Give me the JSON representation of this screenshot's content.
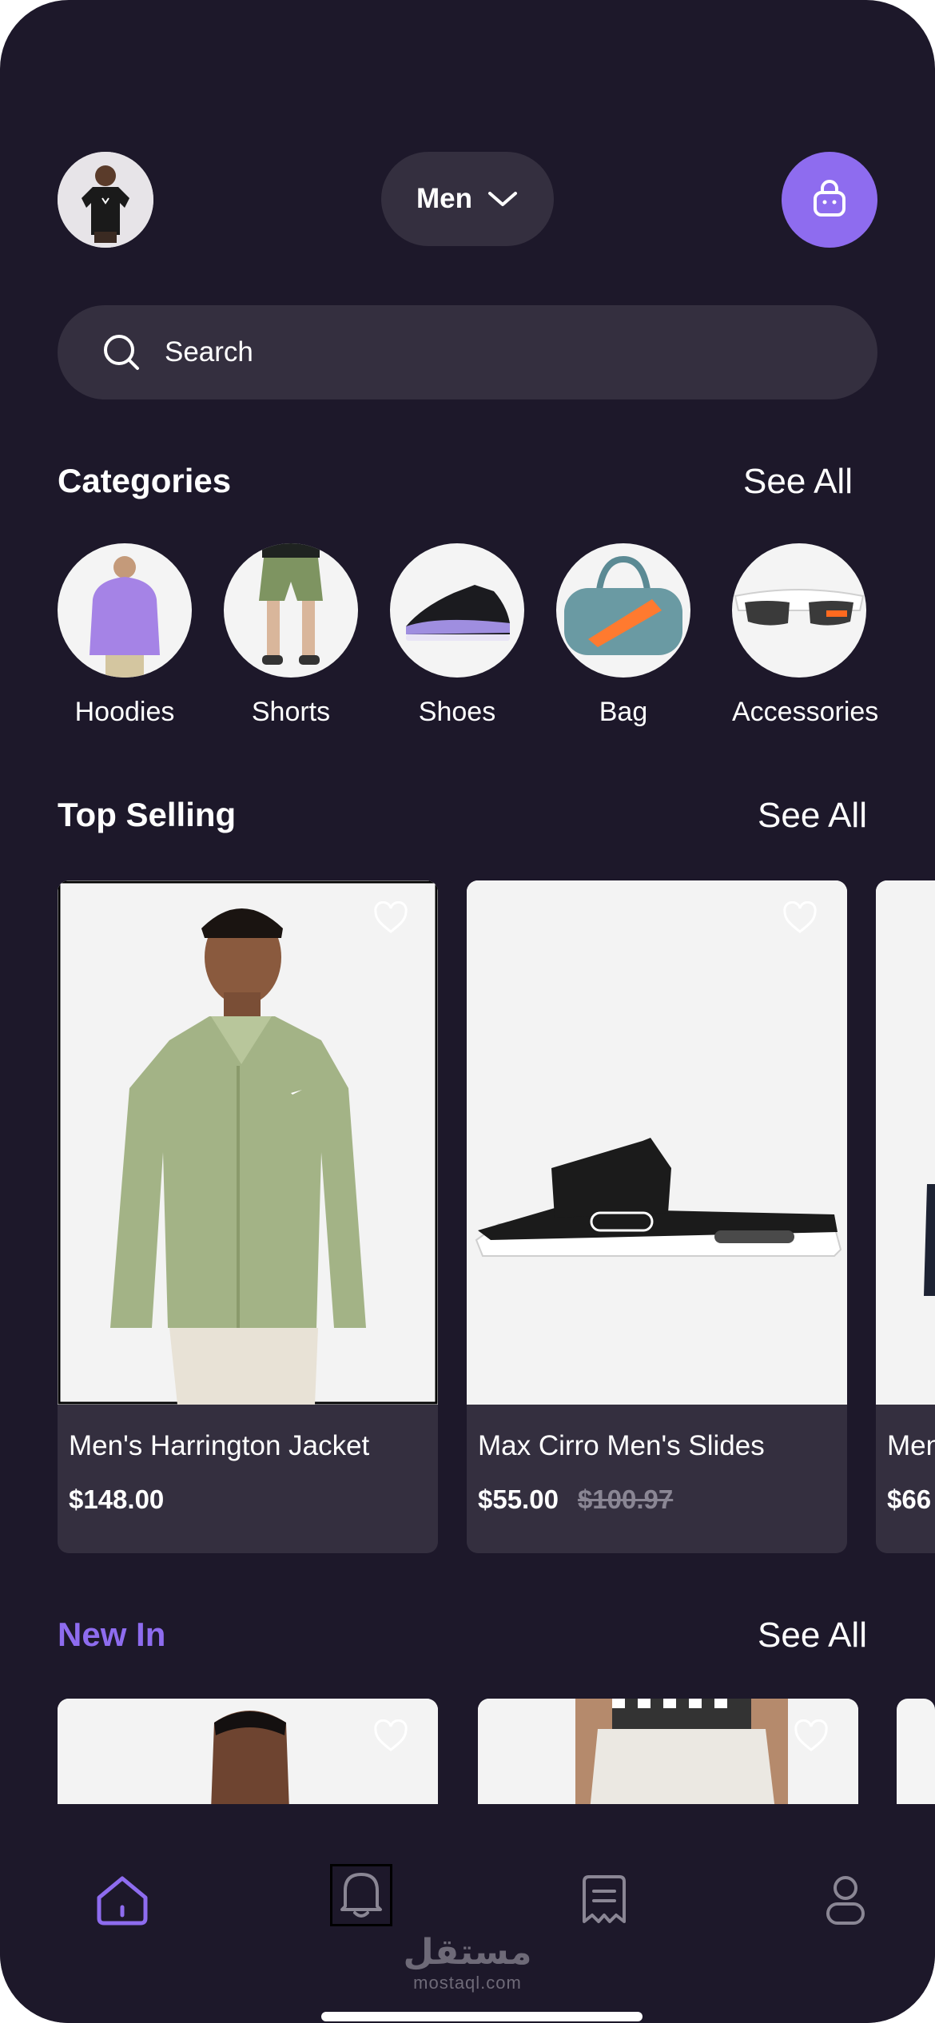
{
  "header": {
    "gender_selected": "Men"
  },
  "search": {
    "placeholder": "Search"
  },
  "categories": {
    "title": "Categories",
    "see_all": "See All",
    "items": [
      {
        "label": "Hoodies"
      },
      {
        "label": "Shorts"
      },
      {
        "label": "Shoes"
      },
      {
        "label": "Bag"
      },
      {
        "label": "Accessories"
      }
    ]
  },
  "top_selling": {
    "title": "Top Selling",
    "see_all": "See All",
    "products": [
      {
        "name": "Men's Harrington Jacket",
        "price": "$148.00",
        "old_price": ""
      },
      {
        "name": "Max Cirro Men's Slides",
        "price": "$55.00",
        "old_price": "$100.97"
      },
      {
        "name": "Men",
        "price": "$66",
        "old_price": ""
      }
    ]
  },
  "new_in": {
    "title": "New In",
    "see_all": "See All",
    "title_color": "#8e6cef"
  },
  "nav": {
    "items": [
      "home-icon",
      "bell-icon",
      "orders-icon",
      "profile-icon"
    ],
    "active": "home-icon"
  },
  "watermark": {
    "arabic": "مستقل",
    "latin": "mostaql.com"
  },
  "colors": {
    "background": "#1d182a",
    "surface": "#342f3f",
    "accent": "#8e6cef"
  }
}
